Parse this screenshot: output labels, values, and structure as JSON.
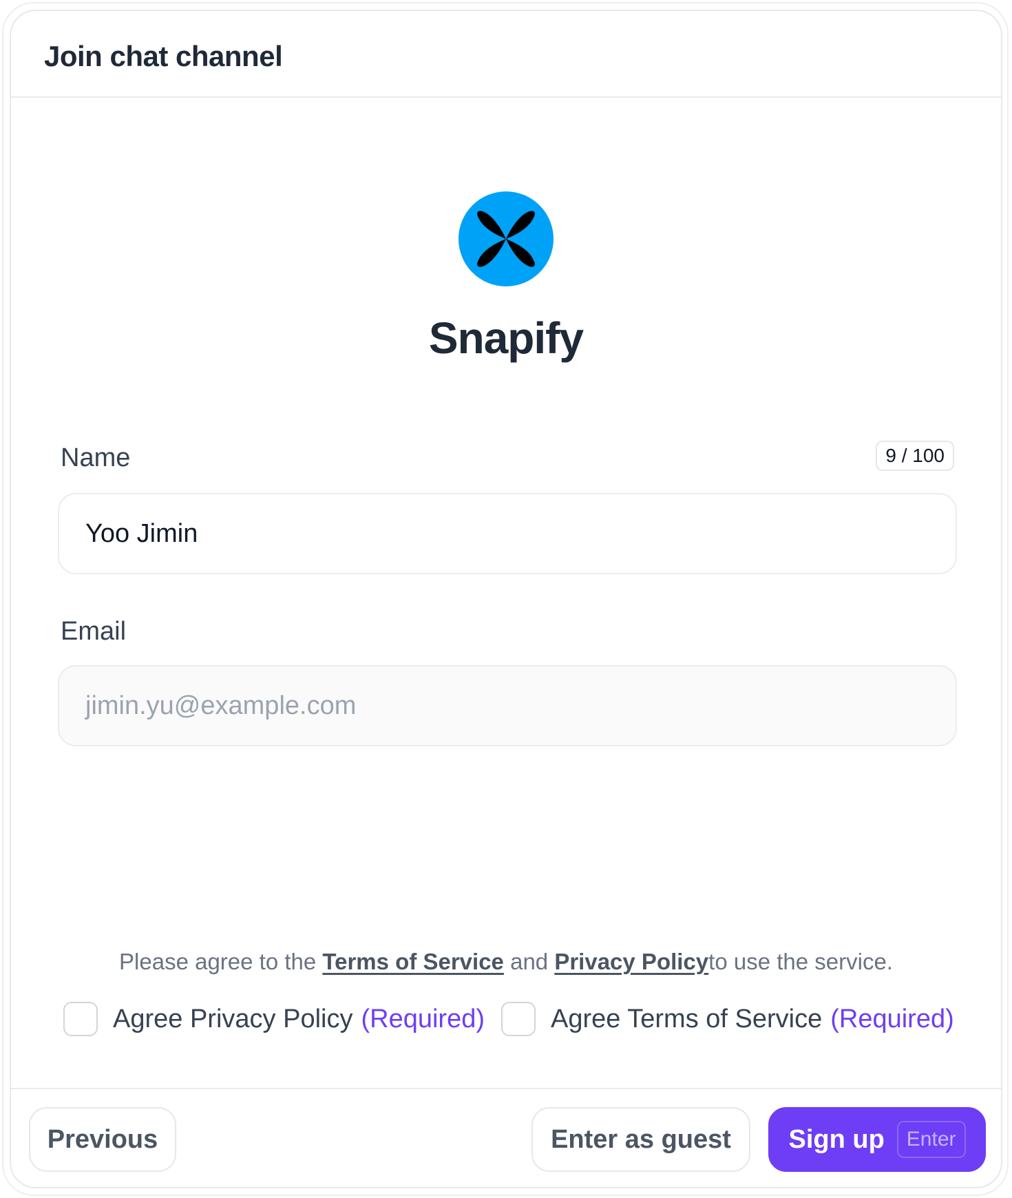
{
  "header": {
    "title": "Join chat channel"
  },
  "brand": {
    "name": "Snapify",
    "logo_icon": "butterfly-x-logo-icon",
    "logo_color": "#00a2f7"
  },
  "form": {
    "name": {
      "label": "Name",
      "value": "Yoo Jimin",
      "counter": "9 / 100"
    },
    "email": {
      "label": "Email",
      "placeholder": "jimin.yu@example.com",
      "value": ""
    }
  },
  "terms": {
    "prefix": "Please agree to the ",
    "tos_link": "Terms of Service",
    "and": " and ",
    "privacy_link": "Privacy Policy",
    "suffix": "to use the service."
  },
  "consents": [
    {
      "label": "Agree Privacy Policy",
      "required": "(Required)",
      "checked": false
    },
    {
      "label": "Agree Terms of Service",
      "required": "(Required)",
      "checked": false
    }
  ],
  "footer": {
    "previous_label": "Previous",
    "guest_label": "Enter as guest",
    "signup_label": "Sign up",
    "signup_shortcut": "Enter"
  },
  "colors": {
    "accent": "#6d3ef5",
    "logo": "#00a2f7",
    "text": "#1f2937"
  }
}
